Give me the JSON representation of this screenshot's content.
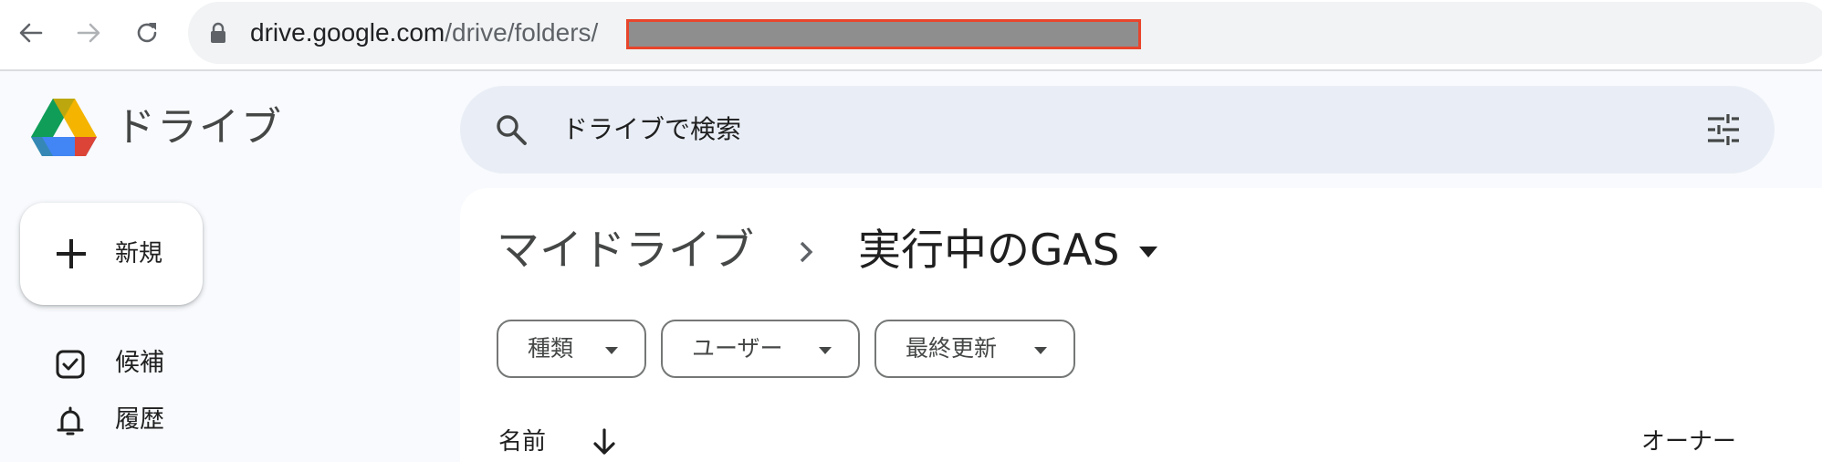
{
  "browser": {
    "url_host": "drive.google.com",
    "url_path": "/drive/folders/"
  },
  "header": {
    "app_name": "ドライブ",
    "search_placeholder": "ドライブで検索"
  },
  "sidebar": {
    "new_label": "新規",
    "items": [
      {
        "label": "候補",
        "icon": "checkbox-icon"
      },
      {
        "label": "履歴",
        "icon": "bell-icon"
      }
    ]
  },
  "breadcrumb": {
    "root": "マイドライブ",
    "current": "実行中のGAS"
  },
  "filters": [
    {
      "label": "種類"
    },
    {
      "label": "ユーザー"
    },
    {
      "label": "最終更新"
    }
  ],
  "table": {
    "columns": {
      "name": "名前",
      "owner": "オーナー"
    }
  },
  "colors": {
    "accent_redaction_border": "#e8452c",
    "search_bg": "#e9eef6",
    "drive_blue": "#4285f4",
    "drive_green": "#0f9d58",
    "drive_yellow": "#f4b400",
    "drive_red": "#db4437"
  }
}
